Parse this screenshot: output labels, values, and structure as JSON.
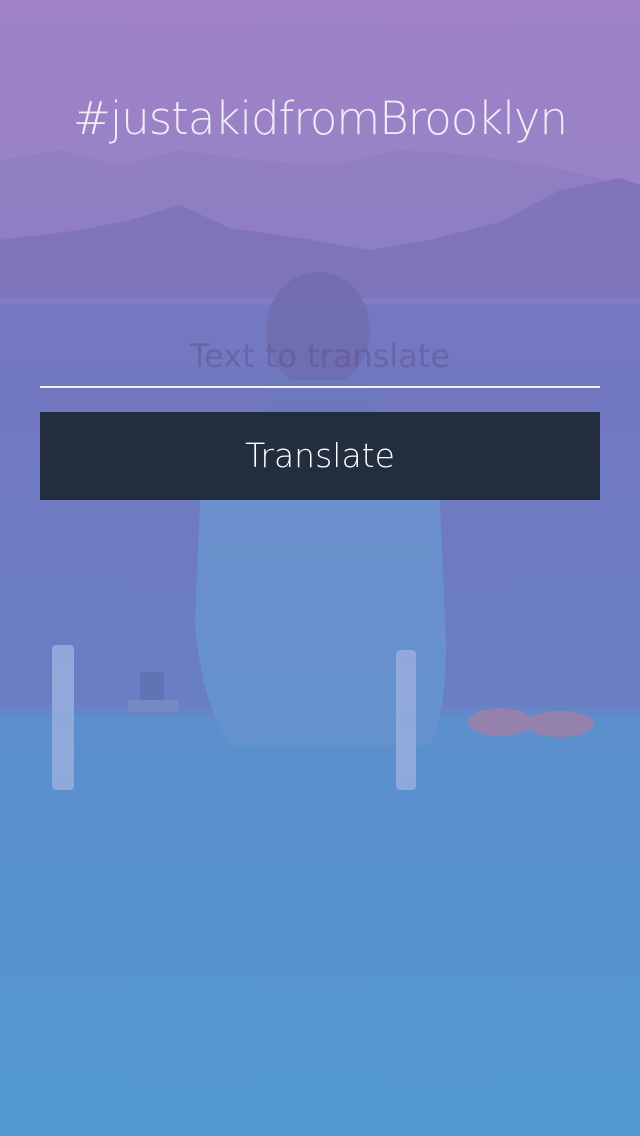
{
  "header": {
    "hashtag": "#justakidfromBrooklyn"
  },
  "form": {
    "input_value": "",
    "input_placeholder": "Text to translate",
    "translate_label": "Translate"
  },
  "colors": {
    "button_bg": "#222d3d",
    "gradient_top": "#9a7fbf",
    "gradient_bottom": "#4aa3d6"
  }
}
